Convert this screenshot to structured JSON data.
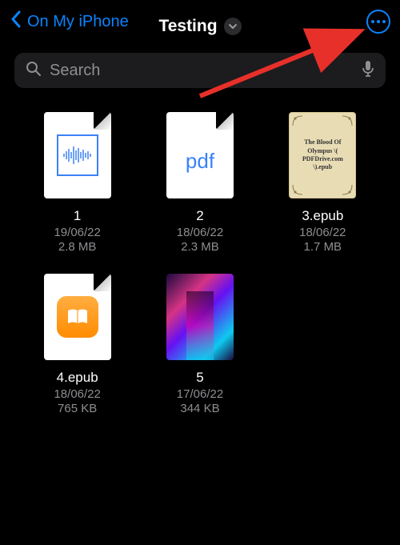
{
  "header": {
    "back_label": "On My iPhone",
    "title": "Testing"
  },
  "search": {
    "placeholder": "Search"
  },
  "files": [
    {
      "name": "1",
      "date": "19/06/22",
      "size": "2.8 MB",
      "kind": "audio"
    },
    {
      "name": "2",
      "date": "18/06/22",
      "size": "2.3 MB",
      "kind": "pdf"
    },
    {
      "name": "3.epub",
      "date": "18/06/22",
      "size": "1.7 MB",
      "kind": "epub-cover",
      "cover_text": "The Blood Of Olympus \\( PDFDrive.com \\).epub"
    },
    {
      "name": "4.epub",
      "date": "18/06/22",
      "size": "765 KB",
      "kind": "ibooks"
    },
    {
      "name": "5",
      "date": "17/06/22",
      "size": "344 KB",
      "kind": "photo"
    }
  ]
}
